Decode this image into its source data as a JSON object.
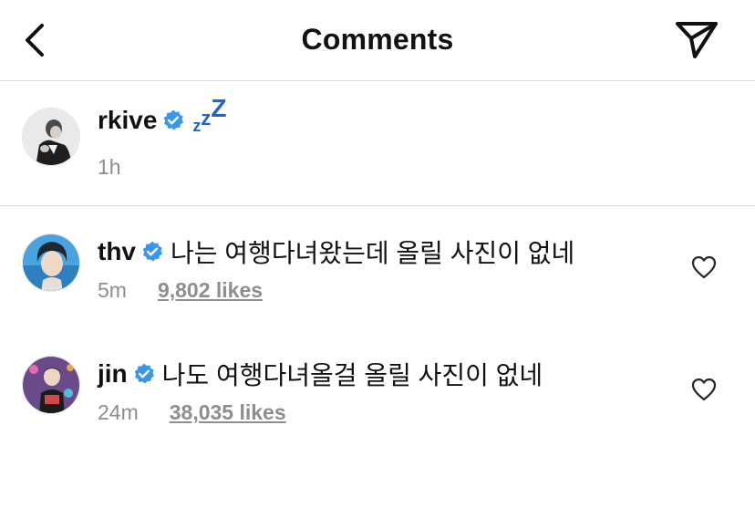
{
  "header": {
    "title": "Comments",
    "back_icon": "chevron-left-icon",
    "share_icon": "paper-plane-icon"
  },
  "caption": {
    "username": "rkive",
    "verified": true,
    "text_emoji": "zzZ",
    "time": "1h"
  },
  "comments": [
    {
      "username": "thv",
      "verified": true,
      "text": "나는 여행다녀왔는데 올릴 사진이 없네",
      "time": "5m",
      "likes": "9,802 likes"
    },
    {
      "username": "jin",
      "verified": true,
      "text": "나도 여행다녀올걸 올릴 사진이 없네",
      "time": "24m",
      "likes": "38,035 likes"
    }
  ],
  "colors": {
    "verified_blue": "#3897f0",
    "divider": "#dbdbdb",
    "muted_text": "#8e8e8e",
    "zzz_blue": "#1d63d6"
  }
}
